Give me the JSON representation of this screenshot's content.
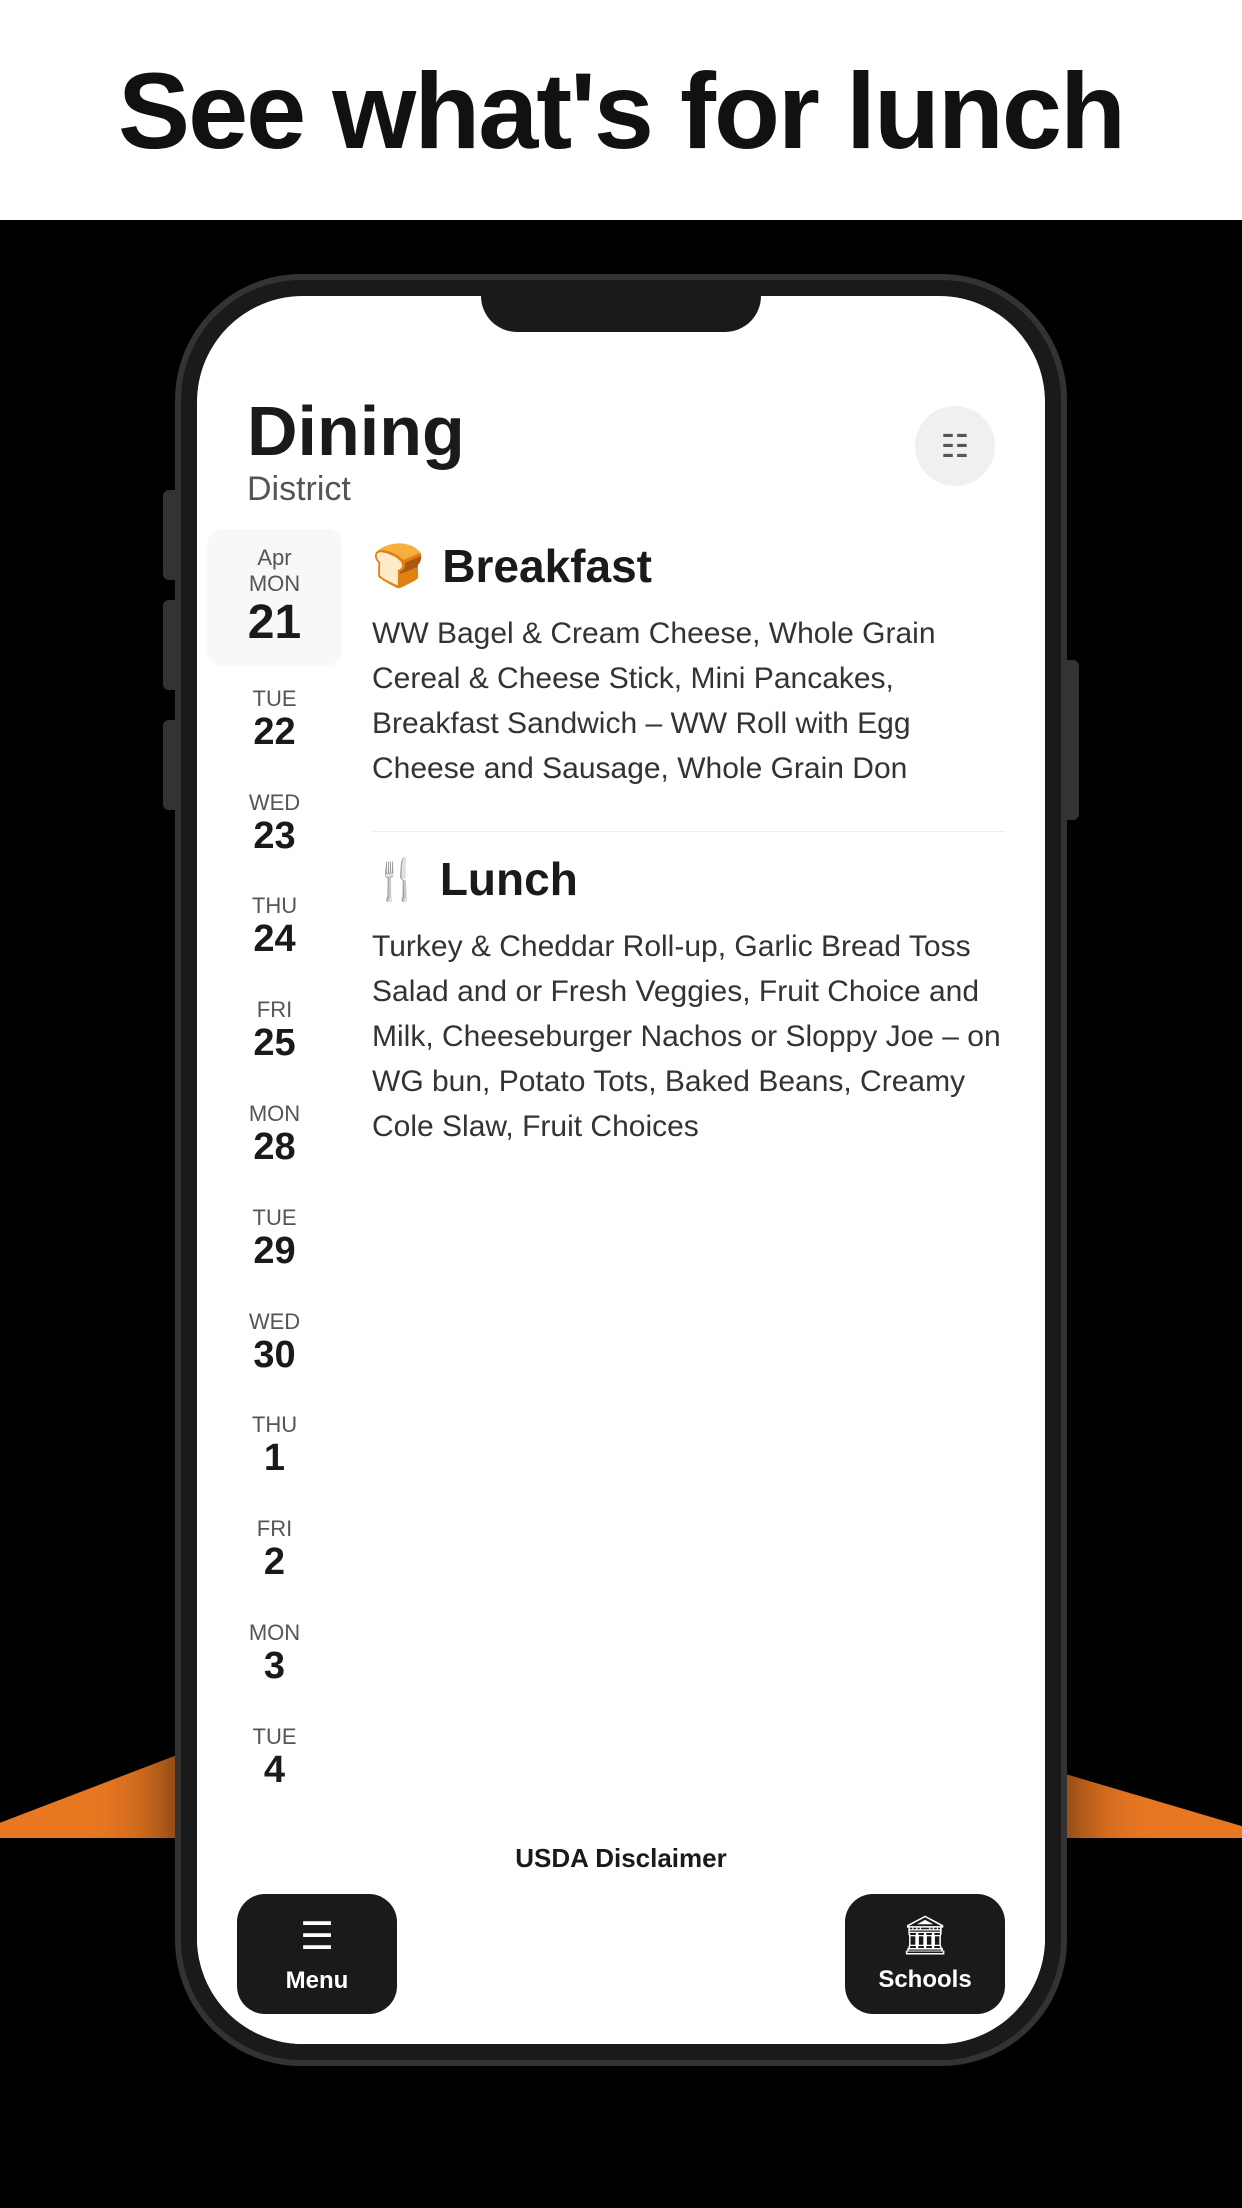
{
  "page": {
    "headline": "See what's for lunch",
    "background_top": "#ffffff",
    "background_bottom": "#000000"
  },
  "phone": {
    "app_title": "Dining",
    "app_subtitle": "District"
  },
  "dates": [
    {
      "month": "Apr",
      "day_name": "MON",
      "number": "21",
      "active": true
    },
    {
      "month": "",
      "day_name": "TUE",
      "number": "22",
      "active": false
    },
    {
      "month": "",
      "day_name": "WED",
      "number": "23",
      "active": false
    },
    {
      "month": "",
      "day_name": "THU",
      "number": "24",
      "active": false
    },
    {
      "month": "",
      "day_name": "FRI",
      "number": "25",
      "active": false
    },
    {
      "month": "",
      "day_name": "MON",
      "number": "28",
      "active": false
    },
    {
      "month": "",
      "day_name": "TUE",
      "number": "29",
      "active": false
    },
    {
      "month": "",
      "day_name": "WED",
      "number": "30",
      "active": false
    },
    {
      "month": "",
      "day_name": "THU",
      "number": "1",
      "active": false
    },
    {
      "month": "",
      "day_name": "FRI",
      "number": "2",
      "active": false
    },
    {
      "month": "",
      "day_name": "MON",
      "number": "3",
      "active": false
    },
    {
      "month": "",
      "day_name": "TUE",
      "number": "4",
      "active": false
    }
  ],
  "meals": {
    "breakfast": {
      "title": "Breakfast",
      "description": "WW Bagel & Cream Cheese, Whole Grain Cereal & Cheese Stick, Mini Pancakes, Breakfast Sandwich – WW Roll with Egg Cheese and Sausage, Whole Grain Don"
    },
    "lunch": {
      "title": "Lunch",
      "description": "Turkey & Cheddar Roll-up, Garlic Bread Toss Salad and or Fresh Veggies, Fruit Choice and Milk, Cheeseburger Nachos or Sloppy Joe – on WG bun, Potato Tots, Baked Beans, Creamy Cole Slaw, Fruit Choices"
    }
  },
  "footer": {
    "usda": "USDA Disclaimer"
  },
  "nav": {
    "menu_label": "Menu",
    "schools_label": "Schools"
  },
  "icons": {
    "filter": "≡",
    "breakfast": "🍞",
    "lunch": "🍴",
    "menu_nav": "☰",
    "schools_nav": "🏛"
  }
}
